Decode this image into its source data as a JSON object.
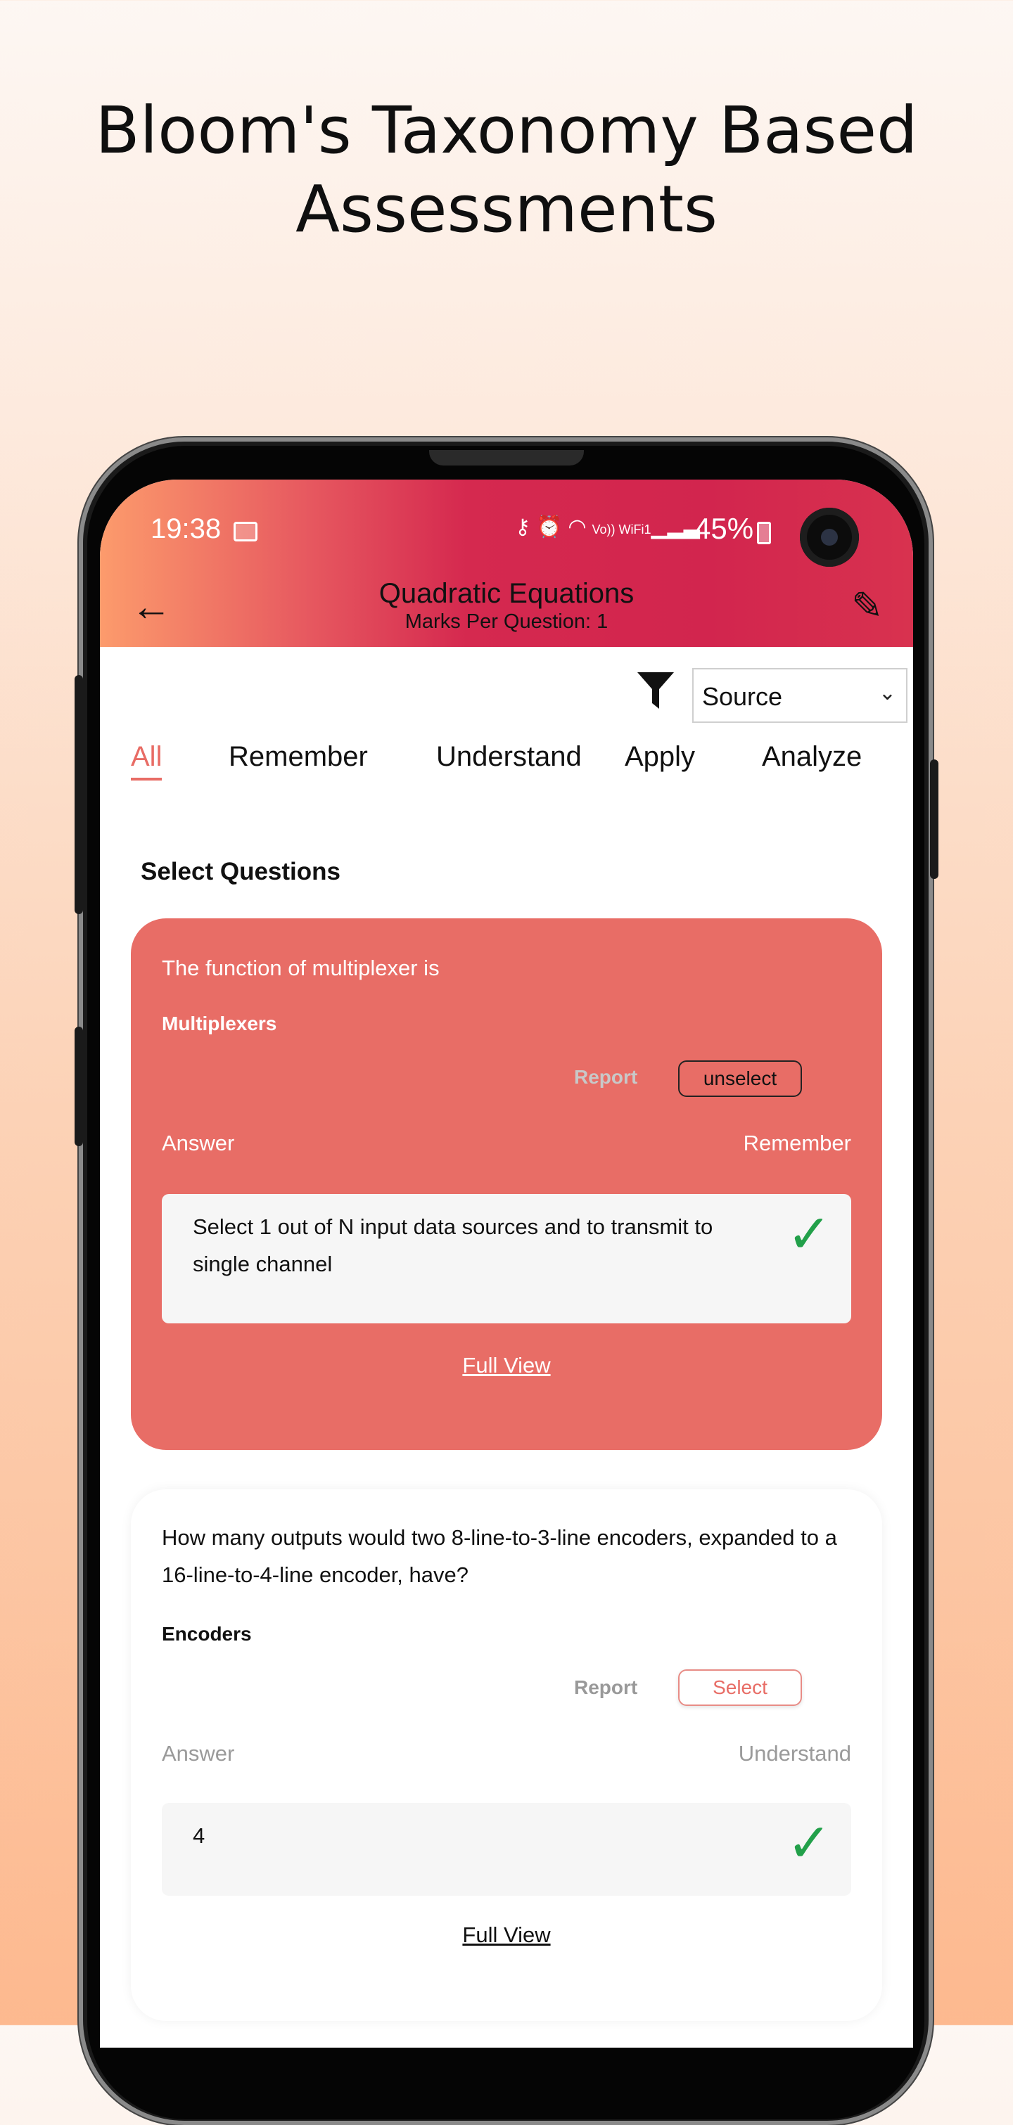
{
  "headline": {
    "line1": "Bloom's Taxonomy Based",
    "line2": "Assessments"
  },
  "status_bar": {
    "time": "19:38",
    "network_label": "Vo)) WiFi1",
    "battery_percent": "45%"
  },
  "app_bar": {
    "title": "Quadratic Equations",
    "subtitle": "Marks Per Question: 1",
    "back_icon": "arrow-left-icon",
    "edit_icon": "pencil-icon"
  },
  "filter": {
    "icon": "filter-icon",
    "source_select": "Source"
  },
  "tabs": [
    {
      "label": "All",
      "active": true
    },
    {
      "label": "Remember",
      "active": false
    },
    {
      "label": "Understand",
      "active": false
    },
    {
      "label": "Apply",
      "active": false
    },
    {
      "label": "Analyze",
      "active": false
    }
  ],
  "section_title": "Select Questions",
  "questions": [
    {
      "question": "The function of multiplexer is",
      "topic": "Multiplexers",
      "report_label": "Report",
      "action_label": "unselect",
      "answer_label": "Answer",
      "level": "Remember",
      "answer": "Select 1 out of N input data sources and to transmit to single channel",
      "full_view": "Full View",
      "selected": true
    },
    {
      "question": "How many outputs would two 8-line-to-3-line encoders, expanded to a 16-line-to-4-line encoder, have?",
      "topic": "Encoders",
      "report_label": "Report",
      "action_label": "Select",
      "answer_label": "Answer",
      "level": "Understand",
      "answer": "4",
      "full_view": "Full View",
      "selected": false
    }
  ],
  "colors": {
    "accent": "#e86d66",
    "appbar_start": "#fc9b6c",
    "appbar_end": "#d2254e",
    "check": "#22a04a"
  }
}
